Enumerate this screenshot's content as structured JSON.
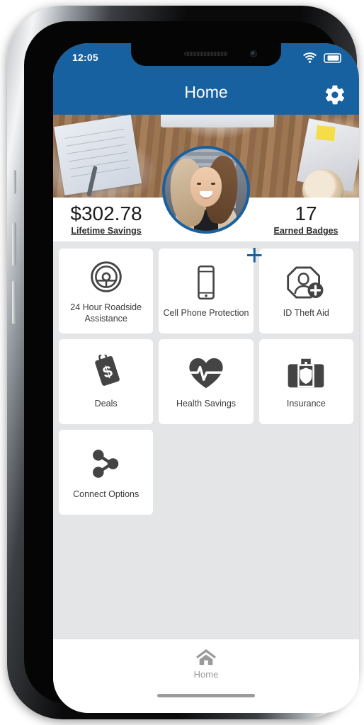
{
  "status_bar": {
    "time": "12:05",
    "wifi_icon": "wifi-icon",
    "battery_icon": "battery-icon"
  },
  "header": {
    "title": "Home",
    "settings_icon": "gear-icon",
    "background_color": "#1861a0"
  },
  "hero": {
    "avatar_alt": "profile-photo",
    "add_button_label": "+",
    "accent_color": "#1861a0"
  },
  "stats": [
    {
      "value": "$302.78",
      "label": "Lifetime Savings"
    },
    {
      "value": "17",
      "label": "Earned Badges"
    }
  ],
  "tiles": [
    {
      "label": "24 Hour Roadside Assistance",
      "icon": "steering-wheel-icon"
    },
    {
      "label": "Cell Phone Protection",
      "icon": "smartphone-icon"
    },
    {
      "label": "ID Theft Aid",
      "icon": "id-theft-icon"
    },
    {
      "label": "Deals",
      "icon": "price-tag-dollar-icon"
    },
    {
      "label": "Health Savings",
      "icon": "heart-pulse-icon"
    },
    {
      "label": "Insurance",
      "icon": "briefcase-shield-icon"
    },
    {
      "label": "Connect Options",
      "icon": "share-nodes-icon"
    }
  ],
  "bottom_nav": [
    {
      "label": "Home",
      "icon": "home-icon",
      "active": true
    }
  ],
  "colors": {
    "brand_blue": "#1861a0",
    "page_background": "#e4e5e7",
    "tile_background": "#ffffff",
    "icon_gray": "#444444",
    "nav_inactive": "#9a9a9a"
  }
}
